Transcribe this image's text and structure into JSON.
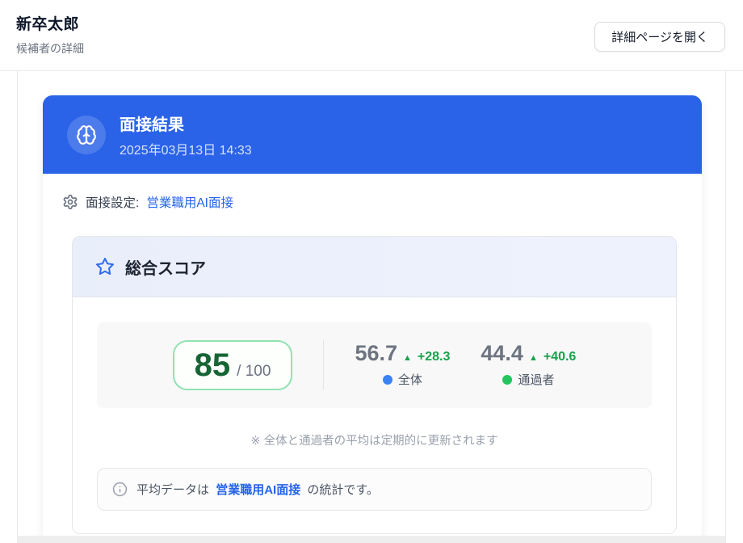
{
  "header": {
    "title": "新卒太郎",
    "subtitle": "候補者の詳細",
    "open_detail_button": "詳細ページを開く"
  },
  "result_card": {
    "title": "面接結果",
    "datetime": "2025年03月13日 14:33",
    "setting_label": "面接設定:",
    "setting_link": "営業職用AI面接"
  },
  "score_card": {
    "title": "総合スコア",
    "score": {
      "value": "85",
      "max_prefix": "/ 100"
    },
    "stats": [
      {
        "value": "56.7",
        "arrow": "▲",
        "delta": "+28.3",
        "label": "全体",
        "dot_color": "#3b82f6"
      },
      {
        "value": "44.4",
        "arrow": "▲",
        "delta": "+40.6",
        "label": "通過者",
        "dot_color": "#22c55e"
      }
    ],
    "note": "※ 全体と通過者の平均は定期的に更新されます",
    "info": {
      "prefix": "平均データは",
      "link": "営業職用AI面接",
      "suffix": "の統計です。"
    }
  },
  "colors": {
    "banner_blue": "#2a62e8",
    "link_blue": "#2563eb",
    "score_green": "#166534",
    "score_border_green": "#8fe2b0",
    "delta_green": "#16a34a",
    "dot_blue": "#3b82f6",
    "dot_green": "#22c55e"
  },
  "icons": {
    "banner": "brain-icon",
    "setting": "gear-icon",
    "score_header": "star-icon",
    "info": "info-circle-icon"
  }
}
